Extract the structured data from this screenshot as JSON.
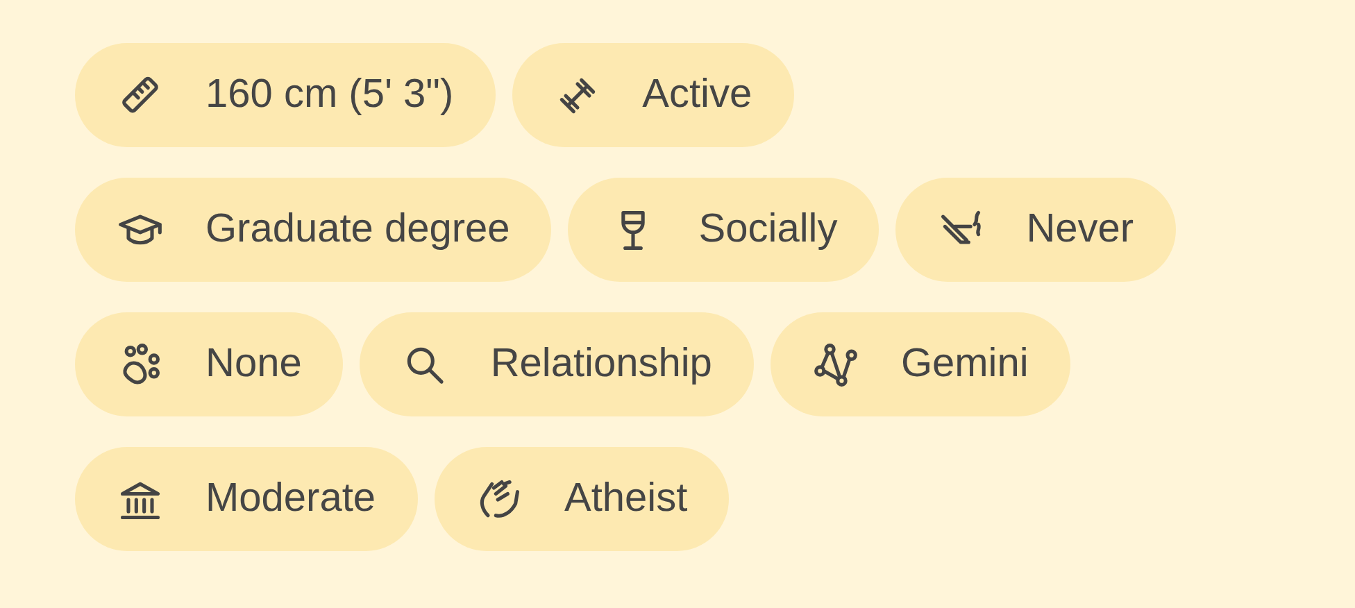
{
  "rows": [
    [
      {
        "kind": "ruler",
        "label": "160 cm (5' 3\")"
      },
      {
        "kind": "dumbbell",
        "label": "Active"
      }
    ],
    [
      {
        "kind": "cap",
        "label": "Graduate degree"
      },
      {
        "kind": "glass",
        "label": "Socially"
      },
      {
        "kind": "nosmoke",
        "label": "Never"
      }
    ],
    [
      {
        "kind": "paw",
        "label": "None"
      },
      {
        "kind": "search",
        "label": "Relationship"
      },
      {
        "kind": "stars",
        "label": "Gemini"
      }
    ],
    [
      {
        "kind": "bank",
        "label": "Moderate"
      },
      {
        "kind": "hands",
        "label": "Atheist"
      }
    ]
  ]
}
